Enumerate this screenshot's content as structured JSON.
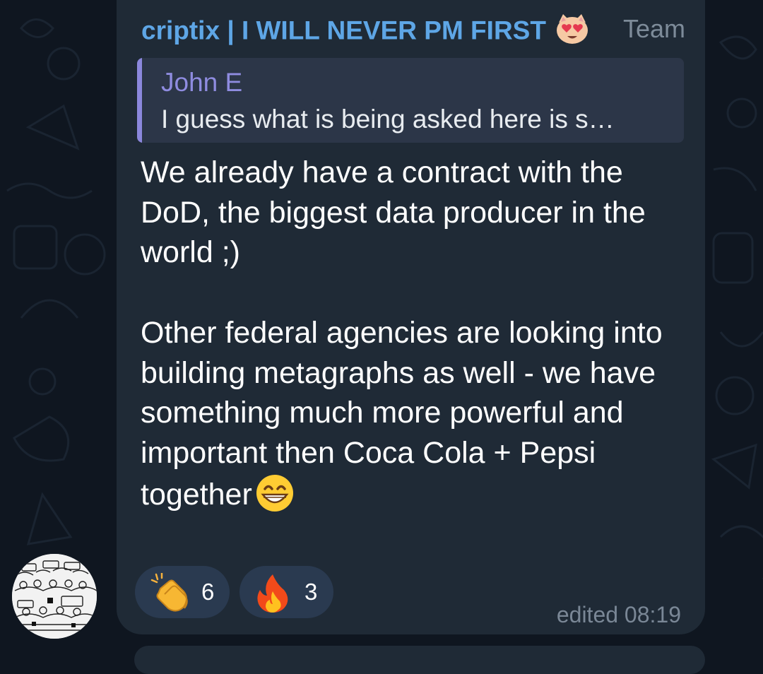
{
  "message": {
    "sender": "criptix | I WILL NEVER PM FIRST",
    "sender_emoji_icon": "heart-eyes-face-icon",
    "role": "Team",
    "reply": {
      "author": "John E",
      "preview": "I guess what is being asked here is s…"
    },
    "paragraph_1": "We already have a contract with the DoD, the biggest data producer in the world ;)",
    "paragraph_2": "Other federal agencies are looking into building metagraphs as well - we have something much more powerful and important then Coca Cola + Pepsi together",
    "trailing_emoji_icon": "grinning-face-icon",
    "reactions": [
      {
        "icon": "clapping-hands-icon",
        "count": "6"
      },
      {
        "icon": "fire-icon",
        "count": "3"
      }
    ],
    "edited_label": "edited 08:19"
  },
  "colors": {
    "background": "#0f1620",
    "bubble": "#1f2a36",
    "sender_name": "#5ea6e6",
    "reply_accent": "#8b87dc",
    "reaction_pill": "#2a3a50",
    "meta_text": "#7a8796"
  }
}
